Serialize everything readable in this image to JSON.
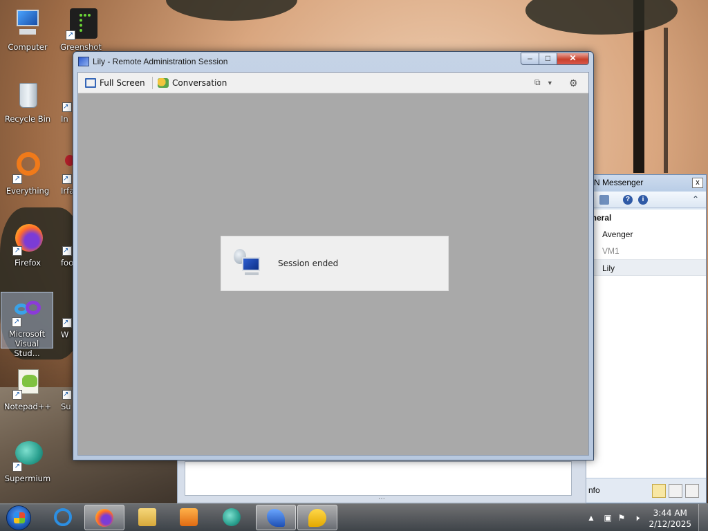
{
  "desktop": {
    "icons": [
      {
        "label": "Computer"
      },
      {
        "label": "Greenshot"
      },
      {
        "label": "Recycle Bin"
      },
      {
        "label": "In"
      },
      {
        "label": "Everything"
      },
      {
        "label": "Irfa"
      },
      {
        "label": "Firefox"
      },
      {
        "label": "foo"
      },
      {
        "label": "Microsoft Visual Stud..."
      },
      {
        "label": "W"
      },
      {
        "label": "Notepad++"
      },
      {
        "label": "Su"
      },
      {
        "label": "Supermium"
      }
    ]
  },
  "remote_window": {
    "title": "Lily - Remote Administration Session",
    "toolbar": {
      "full_screen_label": "Full Screen",
      "conversation_label": "Conversation"
    },
    "session_message": "Session ended",
    "caption": {
      "minimize": "–",
      "maximize": "□",
      "close": "✕"
    }
  },
  "messenger": {
    "title": "N Messenger",
    "close": "x",
    "group": "eneral",
    "contacts": [
      {
        "name": "Avenger",
        "state": "online"
      },
      {
        "name": "VM1",
        "state": "offline"
      },
      {
        "name": "Lily",
        "state": "selected"
      }
    ],
    "status_text": "nfo"
  },
  "taskbar": {
    "apps": [
      "firefox-app",
      "explorer-app",
      "media-player-app",
      "supermium-app",
      "messenger-app",
      "chat-app"
    ],
    "clock": {
      "time": "3:44 AM",
      "date": "2/12/2025"
    }
  },
  "colors": {
    "window_frame": "#c5d3e6",
    "client_bg": "#a9a9a9",
    "close_button": "#c8412c",
    "session_card": "#efefef"
  }
}
